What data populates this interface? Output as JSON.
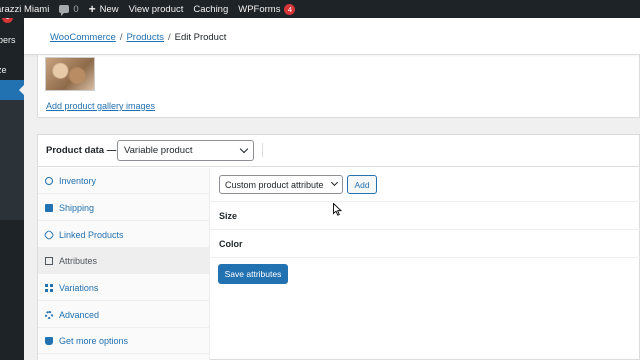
{
  "admin_bar": {
    "site_name": "arazzi Miami",
    "comments_count": "0",
    "new_label": "New",
    "view_product_label": "View product",
    "caching_label": "Caching",
    "wpforms_label": "WPForms",
    "wpforms_badge": "4"
  },
  "admin_menu": {
    "badge": "1",
    "items": [
      "bers",
      "ze"
    ]
  },
  "breadcrumb": {
    "woocommerce": "WooCommerce",
    "sep1": "/",
    "products": "Products",
    "sep2": "/",
    "current": "Edit Product"
  },
  "gallery": {
    "add_link": "Add product gallery images"
  },
  "product_data": {
    "title": "Product data —",
    "type_selected": "Variable product",
    "tabs": [
      {
        "label": "Inventory",
        "icon": "wrench-icon"
      },
      {
        "label": "Shipping",
        "icon": "truck-icon"
      },
      {
        "label": "Linked Products",
        "icon": "link-icon"
      },
      {
        "label": "Attributes",
        "icon": "list-icon"
      },
      {
        "label": "Variations",
        "icon": "grid-icon"
      },
      {
        "label": "Advanced",
        "icon": "gear-icon"
      },
      {
        "label": "Get more options",
        "icon": "plug-icon"
      }
    ],
    "active_tab": "Attributes",
    "attribute_select": "Custom product attribute",
    "add_button": "Add",
    "attributes": [
      "Size",
      "Color"
    ],
    "save_button": "Save attributes"
  },
  "colors": {
    "admin_dark": "#1d2327",
    "accent": "#2271b1",
    "badge": "#d63638"
  }
}
